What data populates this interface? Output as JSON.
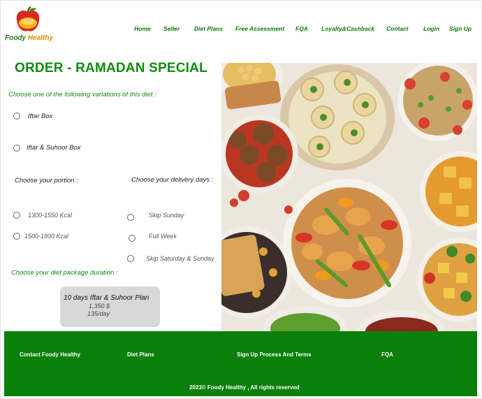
{
  "brand": {
    "name_part1": "Foody ",
    "name_part2": "Healthy"
  },
  "nav": {
    "items": [
      {
        "label": "Home"
      },
      {
        "label": "Seller"
      },
      {
        "label": "Diet Plans"
      },
      {
        "label": "Free Assessment"
      },
      {
        "label": "FQA"
      },
      {
        "label": "Loyalty&Cashback"
      },
      {
        "label": "Contact"
      },
      {
        "label": "Login"
      },
      {
        "label": "Sign Up"
      }
    ]
  },
  "order": {
    "title": "ORDER - RAMADAN SPECIAL",
    "variation_prompt": "Choose one of the following variations of this diet :",
    "variations": [
      {
        "label": "Iftar Box",
        "selected": false
      },
      {
        "label": "Iftar & Suhoor Box",
        "selected": false
      }
    ],
    "portion_prompt": "Choose your portion :",
    "portions": [
      {
        "label": "1300-1550 Kcal",
        "selected": false
      },
      {
        "label": "1500-1800 Kcal",
        "selected": false
      }
    ],
    "delivery_prompt": "Choose your delivery days :",
    "delivery_days": [
      {
        "label": "Skip Sunday",
        "selected": false
      },
      {
        "label": "Full Week",
        "selected": false
      },
      {
        "label": "Skip Saturday & Sunday",
        "selected": false
      }
    ],
    "duration_prompt": "Choose your diet package duration :",
    "plan": {
      "title": "10 days Iftar & Suhoor Plan",
      "price": "1,350 $",
      "per_day": "135/day"
    }
  },
  "footer": {
    "links": [
      "Contact Foody Healthy",
      "Diet Plans",
      "Sign Up Process And Terms",
      "FQA"
    ],
    "copyright": "2023© Foody Healthy , All rights reserved"
  },
  "colors": {
    "brand_green": "#0a7f0a",
    "title_green": "#118a11",
    "card_gray": "#d8d8d8"
  }
}
